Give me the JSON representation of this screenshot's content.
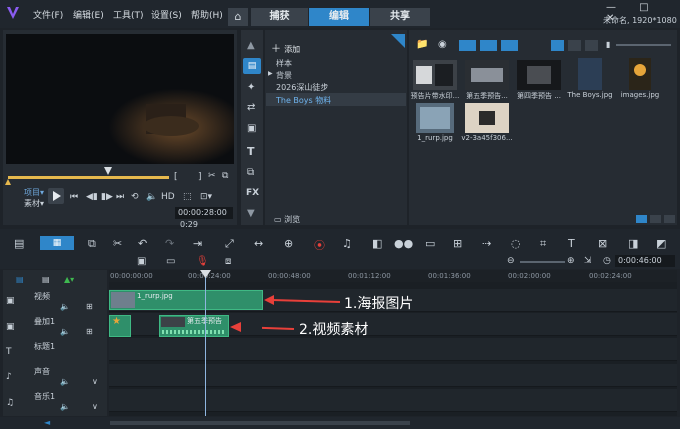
{
  "menu": [
    "文件(F)",
    "编辑(E)",
    "工具(T)",
    "设置(S)",
    "帮助(H)"
  ],
  "tabs": {
    "capture": "捕获",
    "edit": "编辑",
    "share": "共享"
  },
  "window_controls": "—  □  ✕",
  "project_info": "未命名, 1920*1080",
  "player": {
    "mode_project": "项目▾",
    "mode_clip": "素材▾",
    "hd_label": "HD",
    "timecode": "00:00:28:00",
    "duration": "0:29"
  },
  "library": {
    "add_label": "添加",
    "tree": [
      "样本",
      "背景",
      "2026深山徒步",
      "The Boys 物料"
    ],
    "browse_label": "浏览",
    "thumbnails": [
      {
        "label": "预告片带水印..."
      },
      {
        "label": "第五季预告..."
      },
      {
        "label": "第四季预告 ..."
      },
      {
        "label": "The Boys.jpg"
      },
      {
        "label": "images.jpg"
      },
      {
        "label": "1_rurp.jpg"
      },
      {
        "label": "v2-3a45f306..."
      }
    ]
  },
  "timeline": {
    "timecode": "0:00:46:00",
    "ruler": [
      "00:00:00:00",
      "00:00:24:00",
      "00:00:48:00",
      "00:01:12:00",
      "00:01:36:00",
      "00:02:00:00",
      "00:02:24:00"
    ],
    "tracks": [
      {
        "name": "视频"
      },
      {
        "name": "叠加1"
      },
      {
        "name": "标题1"
      },
      {
        "name": "声音"
      },
      {
        "name": "音乐1"
      }
    ],
    "clips": {
      "video_clip_label": "1_rurp.jpg",
      "overlay_clip_label": "第五季预告"
    },
    "annotations": {
      "label1": "1.海报图片",
      "label2": "2.视频素材"
    }
  },
  "colors": {
    "accent_blue": "#2f86c9",
    "annotation_red": "#e8403a",
    "clip_green": "#2f8f6a",
    "scrub_yellow": "#e6b84d"
  }
}
